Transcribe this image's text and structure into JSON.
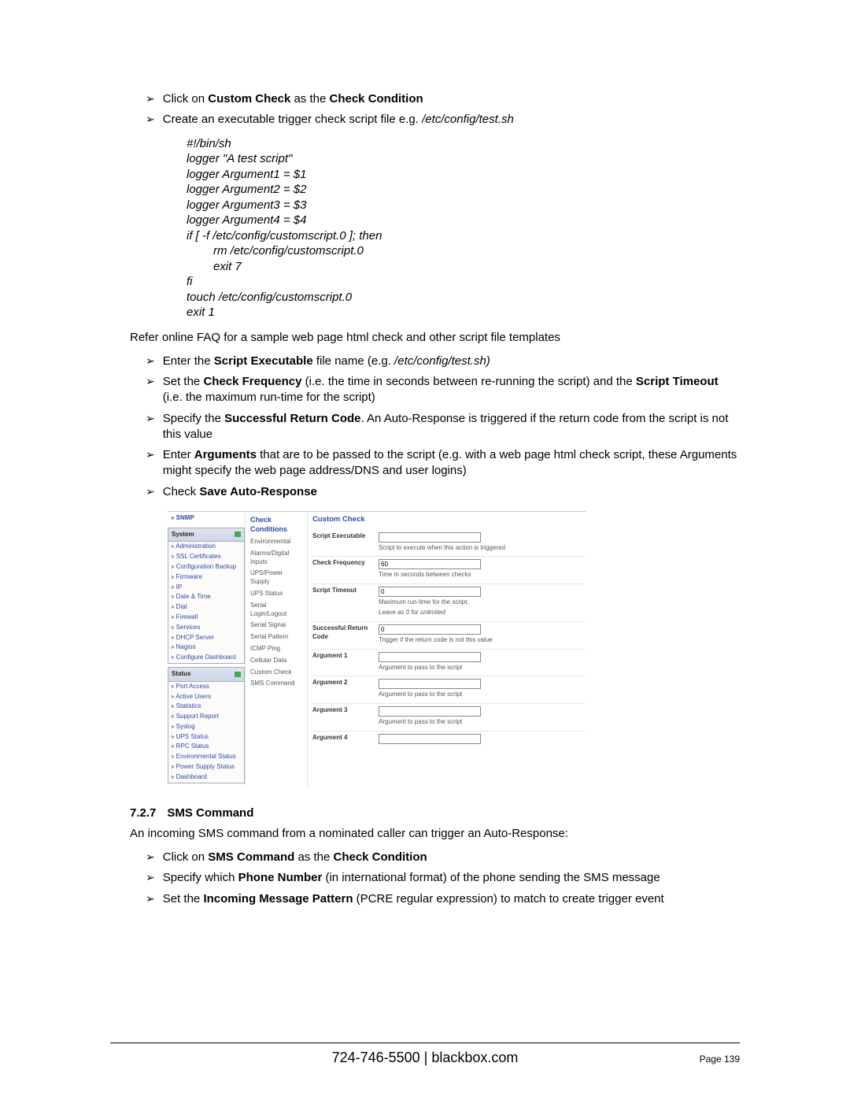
{
  "bullets_top": {
    "b1_a": "Click on ",
    "b1_b": "Custom Check",
    "b1_c": " as the ",
    "b1_d": "Check Condition",
    "b2_a": "Create an executable trigger check script file e.g. ",
    "b2_b": "/etc/config/test.sh"
  },
  "script": {
    "l01": "#!/bin/sh",
    "l02": "logger \"A test script\"",
    "l03": "logger Argument1 = $1",
    "l04": "logger Argument2 = $2",
    "l05": "logger Argument3 = $3",
    "l06": "logger Argument4 = $4",
    "l07": "if [ -f /etc/config/customscript.0 ]; then",
    "l08": "rm /etc/config/customscript.0",
    "l09": "exit 7",
    "l10": "fi",
    "l11": "touch /etc/config/customscript.0",
    "l12": "exit 1"
  },
  "plain1": "Refer online FAQ for a sample web page html check and other script file templates",
  "bullets_mid": {
    "b1_a": "Enter the ",
    "b1_b": "Script Executable",
    "b1_c": " file name (e.g.",
    "b1_d": " /etc/config/test.sh)",
    "b2_a": "Set the ",
    "b2_b": "Check Frequency",
    "b2_c": " (i.e. the time in seconds between re-running the script) and the ",
    "b2_d": "Script Timeout",
    "b2_e": " (i.e. the maximum run-time for the script)",
    "b3_a": "Specify the ",
    "b3_b": "Successful Return Code",
    "b3_c": ". An Auto-Response is triggered if the return code from the script is not this value",
    "b4_a": "Enter ",
    "b4_b": "Arguments",
    "b4_c": " that are to be passed to the script (e.g. with a web page html check script, these Arguments might specify the web page address/DNS and user logins)",
    "b5_a": "Check ",
    "b5_b": "Save Auto-Response"
  },
  "screenshot": {
    "snmp": "» SNMP",
    "panel_system": "System",
    "system_links": [
      "» Administration",
      "» SSL Certificates",
      "» Configuration Backup",
      "» Firmware",
      "» IP",
      "» Date & Time",
      "» Dial",
      "» Firewall",
      "» Services",
      "» DHCP Server",
      "» Nagios",
      "» Configure Dashboard"
    ],
    "panel_status": "Status",
    "status_links": [
      "» Port Access",
      "» Active Users",
      "» Statistics",
      "» Support Report",
      "» Syslog",
      "» UPS Status",
      "» RPC Status",
      "» Environmental Status",
      "» Power Supply Status",
      "» Dashboard"
    ],
    "check_head": "Check Conditions",
    "conditions": [
      "Environmental",
      "Alarms/Digital Inputs",
      "UPS/Power Supply",
      "UPS Status",
      "Serial Login/Logout",
      "Serial Signal",
      "Serial Pattern",
      "ICMP Ping",
      "Cellular Data",
      "Custom Check",
      "SMS Command"
    ],
    "form_title": "Custom Check",
    "lbl_exec": "Script Executable",
    "hint_exec": "Script to execute when this action is triggered",
    "lbl_freq": "Check Frequency",
    "val_freq": "60",
    "hint_freq": "Time in seconds between checks",
    "lbl_timeout": "Script Timeout",
    "val_timeout": "0",
    "hint_timeout_a": "Maximum run-time for the script.",
    "hint_timeout_b": "Leave as 0 for unlimited",
    "lbl_rc": "Successful Return Code",
    "val_rc": "0",
    "hint_rc": "Trigger if the return code is not this value",
    "lbl_arg1": "Argument 1",
    "hint_arg": "Argument to pass to the script",
    "lbl_arg2": "Argument 2",
    "lbl_arg3": "Argument 3",
    "lbl_arg4": "Argument 4"
  },
  "section": {
    "num": "7.2.7",
    "title": "SMS Command",
    "intro": "An incoming SMS command from a nominated caller can trigger an Auto-Response:"
  },
  "bullets_bottom": {
    "b1_a": "Click on ",
    "b1_b": "SMS Command",
    "b1_c": " as the ",
    "b1_d": "Check Condition",
    "b2_a": "Specify which ",
    "b2_b": "Phone Number",
    "b2_c": " (in international format) of the phone sending the SMS message",
    "b3_a": "Set the ",
    "b3_b": "Incoming Message Pattern",
    "b3_c": " (PCRE regular expression) to match to create trigger event"
  },
  "footer": "724-746-5500 | blackbox.com",
  "page_num": "Page 139"
}
